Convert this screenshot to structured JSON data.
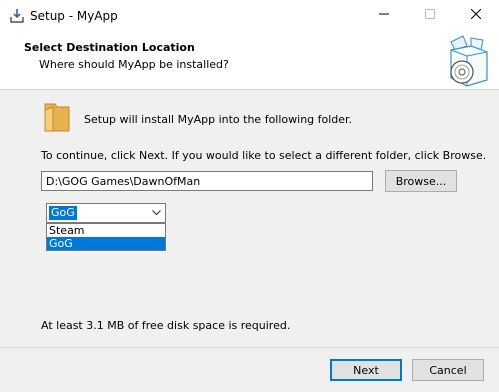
{
  "window": {
    "title": "Setup - MyApp"
  },
  "header": {
    "title": "Select Destination Location",
    "subtitle": "Where should MyApp be installed?"
  },
  "body": {
    "install_message": "Setup will install MyApp into the following folder.",
    "continue_message": "To continue, click Next. If you would like to select a different folder, click Browse.",
    "path_value": "D:\\GOG Games\\DawnOfMan",
    "browse_label": "Browse...",
    "launcher_select": {
      "selected": "GoG",
      "options": [
        "Steam",
        "GoG"
      ],
      "highlighted_option": "GoG"
    },
    "space_message": "At least 3.1 MB of free disk space is required."
  },
  "footer": {
    "next_label": "Next",
    "cancel_label": "Cancel"
  },
  "colors": {
    "accent": "#0078d7",
    "window_bg": "#f0f0f0",
    "header_bg": "#ffffff"
  },
  "icons": [
    "install-icon",
    "minimize-icon",
    "maximize-icon",
    "close-icon",
    "setup-box-icon",
    "folder-icon",
    "chevron-down-icon"
  ]
}
